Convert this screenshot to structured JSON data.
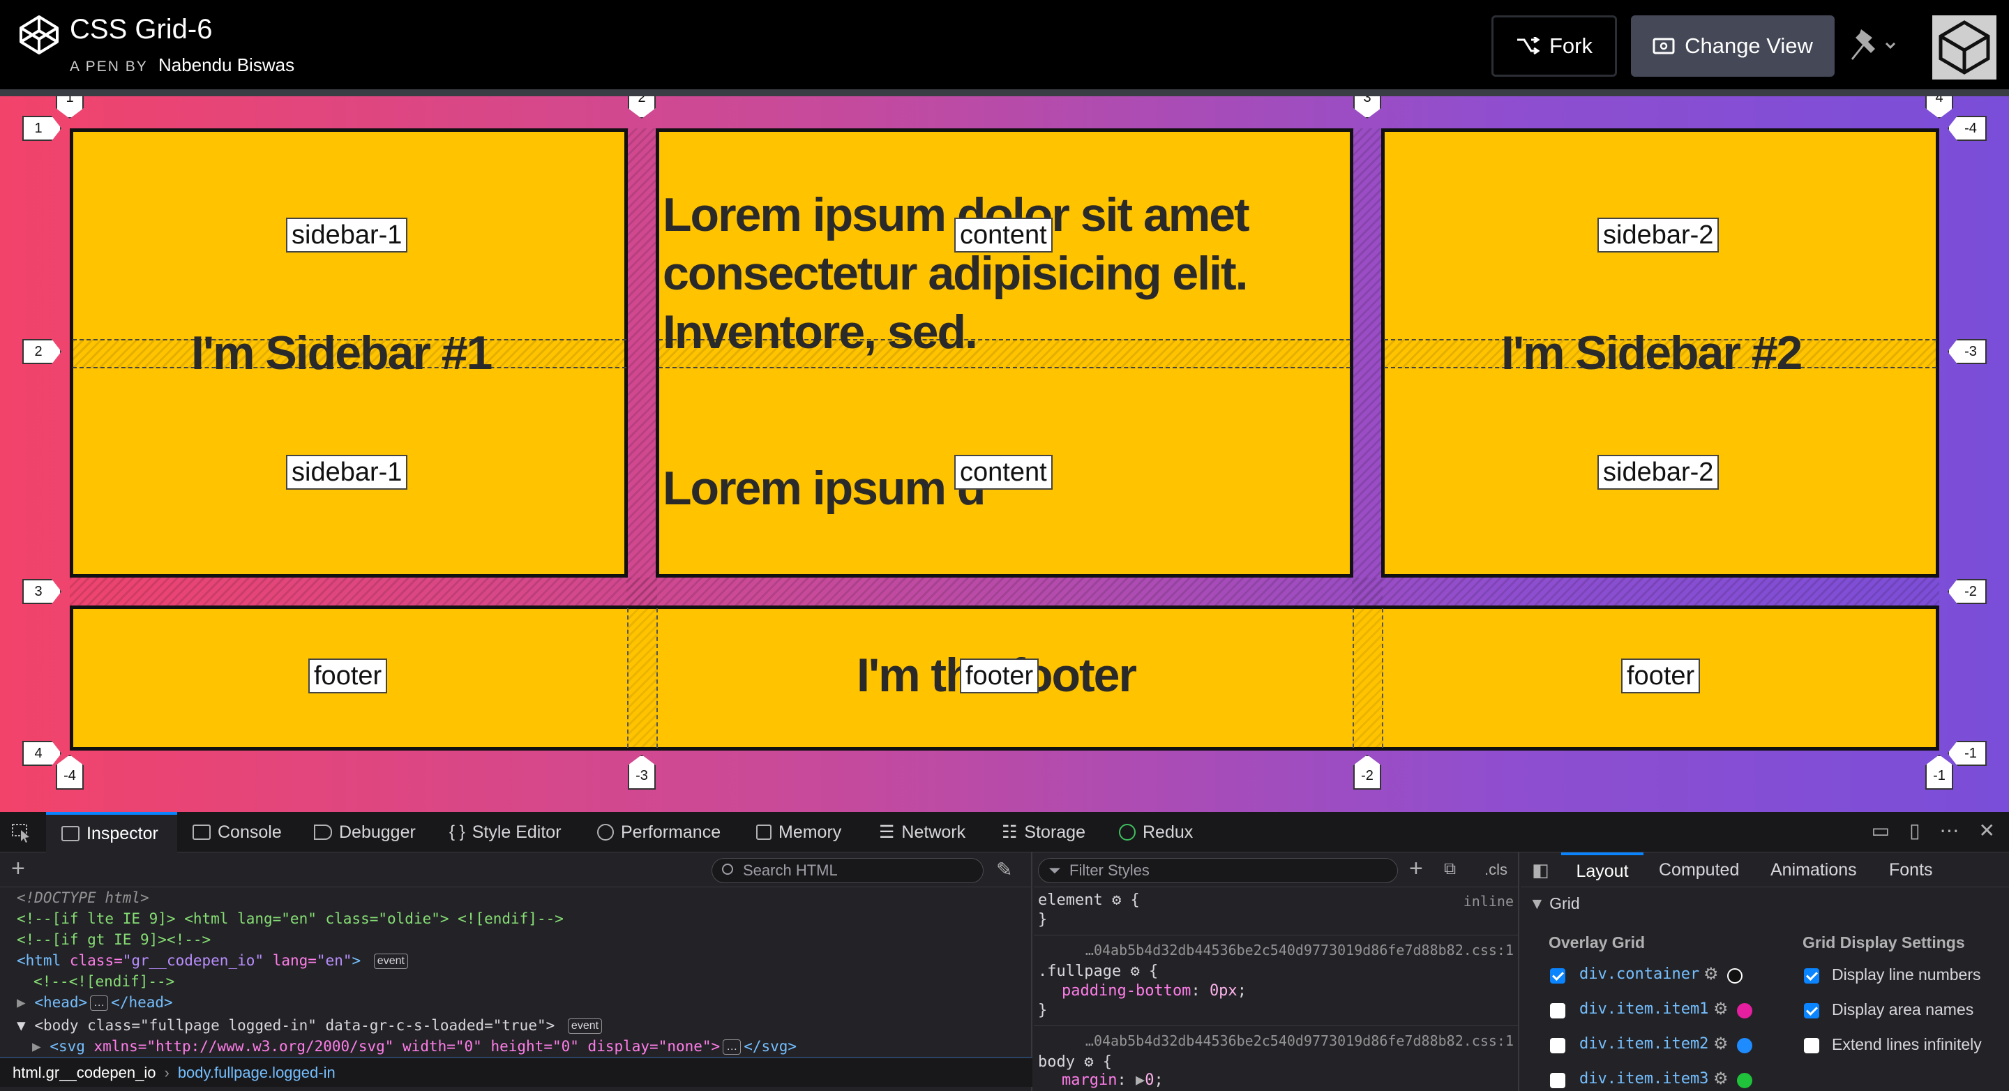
{
  "header": {
    "title": "CSS Grid-6",
    "by_prefix": "A PEN BY",
    "author": "Nabendu Biswas",
    "fork_label": "Fork",
    "change_view_label": "Change View"
  },
  "preview": {
    "sidebar1_text": "I'm Sidebar #1",
    "sidebar2_text": "I'm Sidebar #2",
    "content_text1": "Lorem ipsum dolor sit amet consectetur adipisicing elit. Inventore, sed.",
    "content_text2": "Lorem ipsum d",
    "footer_text": "I'm the footer",
    "area_names": {
      "sidebar1": "sidebar-1",
      "content": "content",
      "sidebar2": "sidebar-2",
      "footer": "footer"
    },
    "col_lines_top": [
      "1",
      "2",
      "3",
      "4"
    ],
    "col_lines_bottom": [
      "-4",
      "-3",
      "-2",
      "-1"
    ],
    "row_lines_left": [
      "1",
      "2",
      "3",
      "4"
    ],
    "row_lines_right": [
      "-4",
      "-3",
      "-2",
      "-1"
    ],
    "background_gradient": [
      "#f2436a",
      "#7a4ed9"
    ],
    "cell_color": "#ffc300"
  },
  "devtools": {
    "tabs": [
      "Inspector",
      "Console",
      "Debugger",
      "Style Editor",
      "Performance",
      "Memory",
      "Network",
      "Storage",
      "Redux"
    ],
    "active_tab": "Inspector",
    "search_html_placeholder": "Search HTML",
    "html_lines": {
      "doctype": "<!DOCTYPE html>",
      "ie_lte": "<!--[if lte IE 9]> <html lang=\"en\" class=\"oldie\"> <![endif]-->",
      "ie_gt": "<!--[if gt IE 9]><!-->",
      "html_open_tag": "<html",
      "html_class_attr": "class=",
      "html_class_val": "\"gr__codepen_io\"",
      "html_lang_attr": "lang=",
      "html_lang_val": "\"en\"",
      "endif": "<!--<![endif]-->",
      "head": "<head>",
      "head_close": "</head>",
      "body_open": "<body class=\"fullpage logged-in\" data-gr-c-s-loaded=\"true\">",
      "svg_tag": "<svg",
      "svg_attrs": " xmlns=\"http://www.w3.org/2000/svg\" width=\"0\" height=\"0\" display=\"none\">",
      "svg_close": "</svg>",
      "event_badge": "event",
      "ellipsis_badge": "…"
    },
    "breadcrumb": [
      "html.gr__codepen_io",
      "body.fullpage.logged-in"
    ],
    "rules": {
      "filter_placeholder": "Filter Styles",
      "cls_label": ".cls",
      "element_selector": "element",
      "inline_label": "inline",
      "source1": "…04ab5b4d32db44536be2c540d9773019d86fe7d88b82.css:1",
      "fullpage_selector": ".fullpage",
      "fullpage_prop": "padding-bottom",
      "fullpage_val": "0px",
      "source2": "…04ab5b4d32db44536be2c540d9773019d86fe7d88b82.css:1",
      "body_selector": "body",
      "body_prop": "margin",
      "body_val": "0",
      "open_brace": "{",
      "close_brace": "}"
    },
    "layout": {
      "tabs": [
        "Layout",
        "Computed",
        "Animations",
        "Fonts"
      ],
      "active_tab": "Layout",
      "section_title": "Grid",
      "overlay_title": "Overlay Grid",
      "settings_title": "Grid Display Settings",
      "overlay_items": [
        {
          "label": "div.container",
          "checked": true,
          "color": "#ffffff"
        },
        {
          "label": "div.item.item1",
          "checked": false,
          "color": "#e61fa0"
        },
        {
          "label": "div.item.item2",
          "checked": false,
          "color": "#1e8cff"
        },
        {
          "label": "div.item.item3",
          "checked": false,
          "color": "#1fc23a"
        }
      ],
      "settings": [
        {
          "label": "Display line numbers",
          "checked": true
        },
        {
          "label": "Display area names",
          "checked": true
        },
        {
          "label": "Extend lines infinitely",
          "checked": false
        }
      ]
    }
  }
}
